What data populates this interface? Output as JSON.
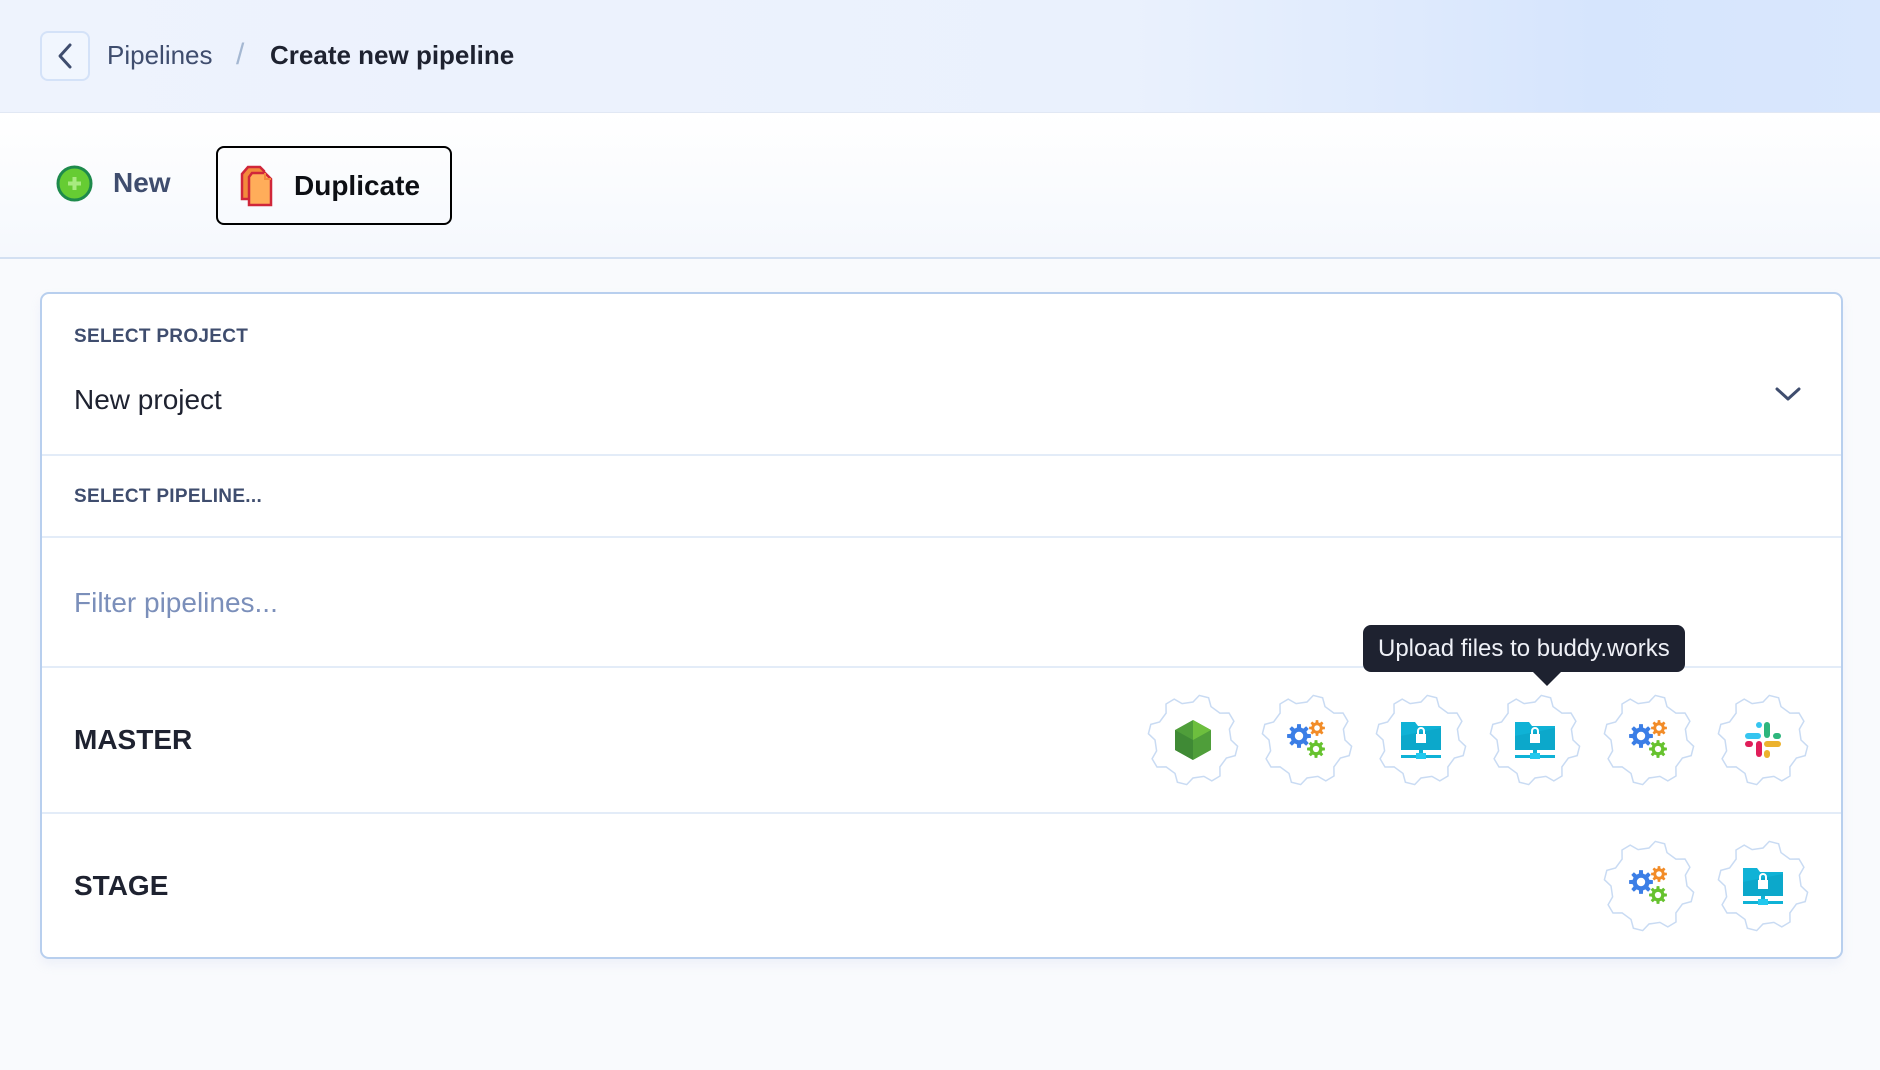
{
  "header": {
    "back_icon": "chevron-left-icon",
    "breadcrumb": {
      "parent": "Pipelines",
      "separator": "/",
      "current": "Create new pipeline"
    }
  },
  "toolbar": {
    "new_label": "New",
    "new_icon": "plus-circle-icon",
    "duplicate_label": "Duplicate",
    "duplicate_icon": "copy-document-icon",
    "duplicate_selected": true
  },
  "form": {
    "project_label": "SELECT PROJECT",
    "project_value": "New project",
    "pipeline_label": "SELECT PIPELINE...",
    "filter_placeholder": "Filter pipelines...",
    "filter_value": ""
  },
  "pipelines": [
    {
      "name": "MASTER",
      "actions": [
        "nodejs-icon",
        "gears-icon",
        "sftp-folder-icon",
        "sftp-folder-icon",
        "gears-icon",
        "slack-icon"
      ]
    },
    {
      "name": "STAGE",
      "actions": [
        "gears-icon",
        "sftp-folder-icon"
      ]
    }
  ],
  "tooltip": {
    "text": "Upload files to buddy.works"
  },
  "colors": {
    "accent_border": "#b8cfee",
    "text_dark": "#1e2230",
    "text_muted": "#3f4d6e",
    "placeholder": "#7b8fba",
    "tooltip_bg": "#1e2230"
  }
}
